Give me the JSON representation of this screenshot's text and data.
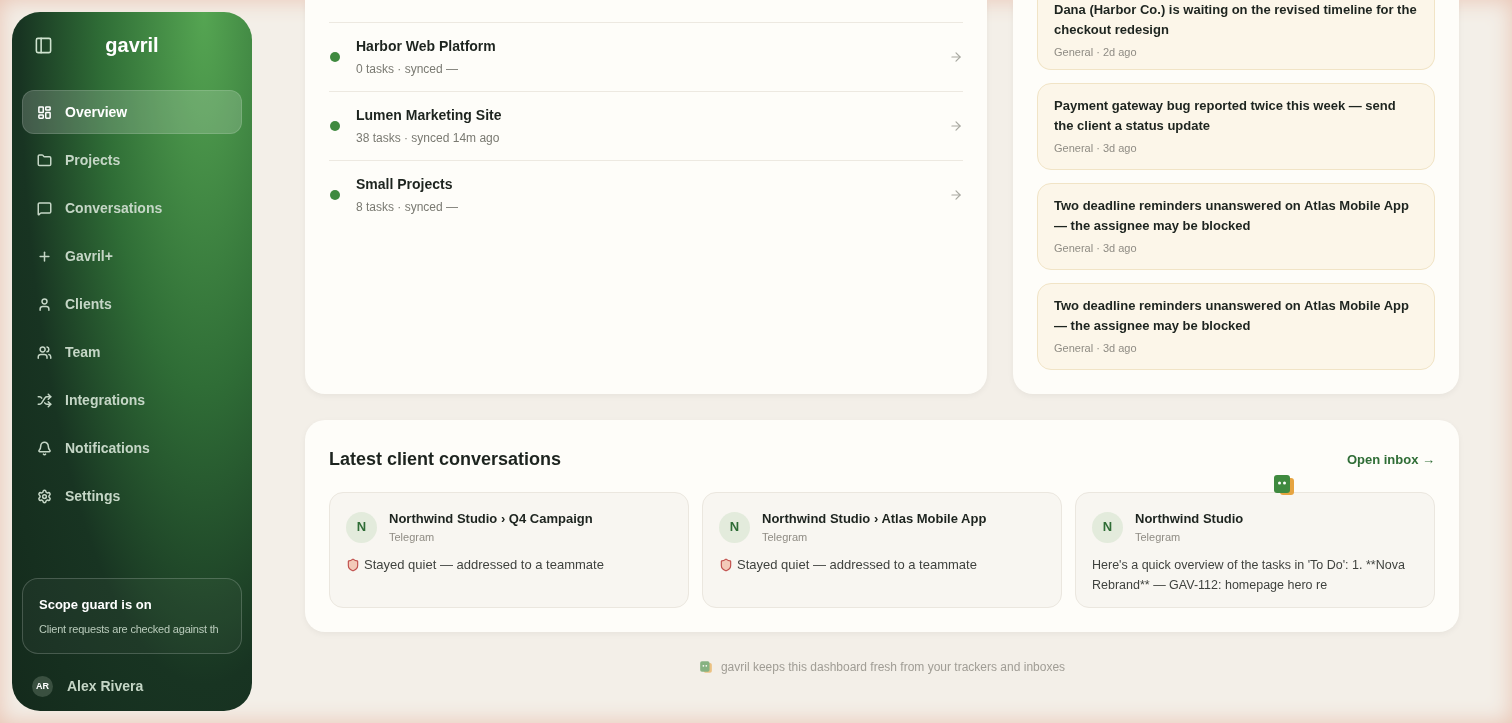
{
  "sidebar": {
    "brand": "gavril",
    "items": [
      {
        "label": "Overview",
        "selected": true
      },
      {
        "label": "Projects",
        "selected": false
      },
      {
        "label": "Conversations",
        "selected": false
      },
      {
        "label": "Gavril+",
        "selected": false
      },
      {
        "label": "Clients",
        "selected": false
      },
      {
        "label": "Team",
        "selected": false
      },
      {
        "label": "Integrations",
        "selected": false
      },
      {
        "label": "Notifications",
        "selected": false
      },
      {
        "label": "Settings",
        "selected": false
      }
    ],
    "scope_guard": {
      "title": "Scope guard is on",
      "text": "Client requests are checked against th"
    },
    "user": {
      "initials": "AR",
      "name": "Alex Rivera"
    }
  },
  "projects": {
    "rows": [
      {
        "name": "Harbor Web Platform",
        "meta": "0 tasks · synced —"
      },
      {
        "name": "Lumen Marketing Site",
        "meta": "38 tasks · synced 14m ago"
      },
      {
        "name": "Small Projects",
        "meta": "8 tasks · synced —"
      }
    ]
  },
  "alerts": [
    {
      "text": "Dana (Harbor Co.) is waiting on the revised timeline for the checkout redesign",
      "meta": "General · 2d ago"
    },
    {
      "text": "Payment gateway bug reported twice this week — send the client a status update",
      "meta": "General · 3d ago"
    },
    {
      "text": "Two deadline reminders unanswered on Atlas Mobile App — the assignee may be blocked",
      "meta": "General · 3d ago"
    },
    {
      "text": "Two deadline reminders unanswered on Atlas Mobile App — the assignee may be blocked",
      "meta": "General · 3d ago"
    }
  ],
  "conversations": {
    "title": "Latest client conversations",
    "link": "Open inbox →",
    "items": [
      {
        "avatar": "N",
        "title": "Northwind Studio › Q4 Campaign",
        "channel": "Telegram",
        "kind": "quiet",
        "preview": "Stayed quiet — addressed to a teammate"
      },
      {
        "avatar": "N",
        "title": "Northwind Studio › Atlas Mobile App",
        "channel": "Telegram",
        "kind": "quiet",
        "preview": "Stayed quiet — addressed to a teammate"
      },
      {
        "avatar": "N",
        "title": "Northwind Studio",
        "channel": "Telegram",
        "kind": "message",
        "preview": "Here's a quick overview of the tasks in 'To Do': 1. **Nova Rebrand** — GAV-112: homepage hero re"
      }
    ]
  },
  "footer": {
    "text": "gavril keeps this dashboard fresh from your trackers and inboxes"
  }
}
